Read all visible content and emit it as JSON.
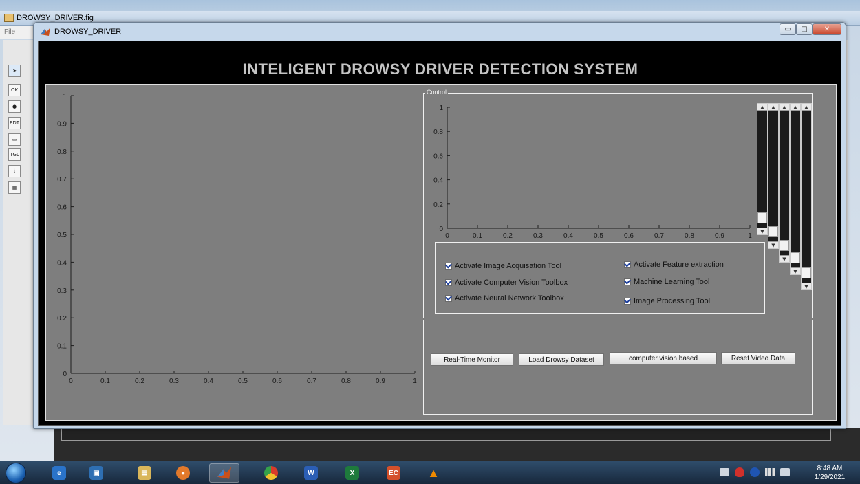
{
  "background_window": {
    "title": "DROWSY_DRIVER.fig",
    "menu_first": "File"
  },
  "figure_window": {
    "title": "DROWSY_DRIVER",
    "controls": {
      "minimize": "▭",
      "maximize": "□",
      "close": "✕"
    }
  },
  "page_title": "INTELIGENT DROWSY DRIVER DETECTION SYSTEM",
  "main_axes": {
    "x_ticks": [
      "0",
      "0.1",
      "0.2",
      "0.3",
      "0.4",
      "0.5",
      "0.6",
      "0.7",
      "0.8",
      "0.9",
      "1"
    ],
    "y_ticks": [
      "0",
      "0.1",
      "0.2",
      "0.3",
      "0.4",
      "0.5",
      "0.6",
      "0.7",
      "0.8",
      "0.9",
      "1"
    ],
    "xlim": [
      0,
      1
    ],
    "ylim": [
      0,
      1
    ]
  },
  "control_panel": {
    "legend": "Control",
    "axes": {
      "x_ticks": [
        "0",
        "0.1",
        "0.2",
        "0.3",
        "0.4",
        "0.5",
        "0.6",
        "0.7",
        "0.8",
        "0.9",
        "1"
      ],
      "y_ticks": [
        "0",
        "0.2",
        "0.4",
        "0.6",
        "0.8",
        "1"
      ],
      "xlim": [
        0,
        1
      ],
      "ylim": [
        0,
        1
      ]
    },
    "checkboxes": [
      {
        "label": "Activate Image Acquisation Tool",
        "checked": true
      },
      {
        "label": "Activate Computer Vision Toolbox",
        "checked": true
      },
      {
        "label": "Activate Neural Network Toolbox",
        "checked": true
      },
      {
        "label": "Activate Feature extraction",
        "checked": true
      },
      {
        "label": "Machine Learning Tool",
        "checked": true
      },
      {
        "label": "Image Processing Tool",
        "checked": true
      }
    ],
    "sliders": [
      {
        "name": "slider-1",
        "value": 0.0
      },
      {
        "name": "slider-2",
        "value": 0.0
      },
      {
        "name": "slider-3",
        "value": 0.0
      },
      {
        "name": "slider-4",
        "value": 0.0
      },
      {
        "name": "slider-5",
        "value": 0.0
      }
    ]
  },
  "buttons": {
    "realtime": "Real-Time Monitor",
    "load_dataset": "Load Drowsy Dataset",
    "cv_based": "computer vision based",
    "reset": "Reset Video Data"
  },
  "taskbar": {
    "apps": [
      "internet-explorer-icon",
      "media-player-icon",
      "file-explorer-icon",
      "firefox-icon",
      "matlab-icon",
      "chrome-icon",
      "word-icon",
      "excel-icon",
      "video-app-icon",
      "vlc-icon"
    ],
    "clock_time": "8:48 AM",
    "clock_date": "1/29/2021"
  },
  "colors": {
    "panel_bg": "#7e7e7e",
    "figure_bg": "#000000",
    "title_text": "#c4c4c4",
    "checkbox_mark": "#1c3e9c"
  }
}
